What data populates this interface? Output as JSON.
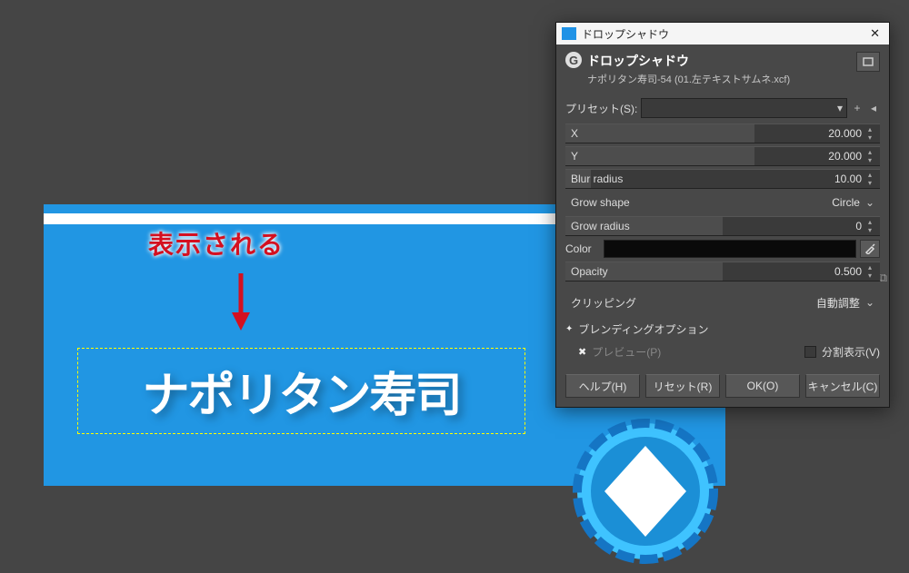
{
  "annotation": {
    "text": "表示される"
  },
  "canvas_text": "ナポリタン寿司",
  "dialog": {
    "window_title": "ドロップシャドウ",
    "close": "✕",
    "title": "ドロップシャドウ",
    "subtitle": "ナポリタン寿司-54 (01.左テキストサムネ.xcf)",
    "preset_label": "プリセット(S):",
    "params": {
      "x_label": "X",
      "x_value": "20.000",
      "y_label": "Y",
      "y_value": "20.000",
      "blur_label": "Blur radius",
      "blur_value": "10.00",
      "grow_shape_label": "Grow shape",
      "grow_shape_value": "Circle",
      "grow_radius_label": "Grow radius",
      "grow_radius_value": "0",
      "color_label": "Color",
      "opacity_label": "Opacity",
      "opacity_value": "0.500",
      "clipping_label": "クリッピング",
      "clipping_value": "自動調整"
    },
    "blending_label": "ブレンディングオプション",
    "preview_label": "プレビュー(P)",
    "split_label": "分割表示(V)",
    "buttons": {
      "help": "ヘルプ(H)",
      "reset": "リセット(R)",
      "ok": "OK(O)",
      "cancel": "キャンセル(C)"
    }
  }
}
